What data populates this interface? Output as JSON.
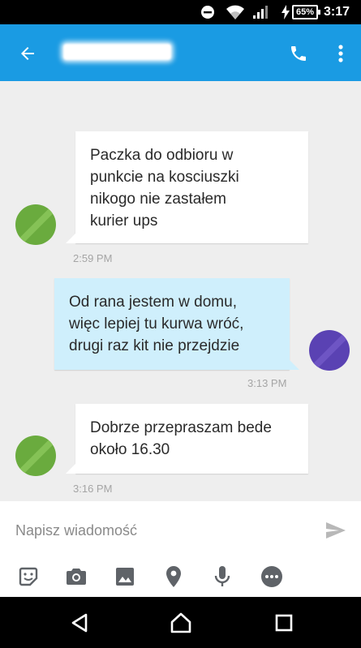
{
  "status_bar": {
    "battery_percent": "65%",
    "time": "3:17",
    "icons": [
      "do-not-disturb-icon",
      "wifi-icon",
      "signal-icon",
      "charging-bolt-icon",
      "battery-icon"
    ]
  },
  "app_bar": {
    "background": "#1a9be3",
    "icons": [
      "back-arrow-icon",
      "phone-icon",
      "more-vert-icon"
    ]
  },
  "messages": [
    {
      "direction": "incoming",
      "text": "Paczka do odbioru w\npunkcie na kosciuszki\nnikogo nie zastałem\nkurier ups",
      "timestamp": "2:59 PM"
    },
    {
      "direction": "outgoing",
      "text": "Od rana jestem w domu,\nwięc lepiej tu kurwa wróć,\ndrugi raz kit nie przejdzie",
      "timestamp": "3:13 PM"
    },
    {
      "direction": "incoming",
      "text": "Dobrze przepraszam bede\nokoło 16.30",
      "timestamp": "3:16 PM"
    }
  ],
  "colors": {
    "incoming_bubble": "#ffffff",
    "outgoing_bubble": "#cfeffc",
    "incoming_avatar": "#6aab3e",
    "outgoing_avatar": "#5a42b3"
  },
  "compose": {
    "placeholder": "Napisz wiadomość",
    "toolbar_icons": [
      "sticker-icon",
      "camera-icon",
      "image-icon",
      "location-pin-icon",
      "microphone-icon",
      "more-horiz-icon"
    ]
  },
  "nav_bar": {
    "icons": [
      "nav-back-icon",
      "nav-home-icon",
      "nav-recents-icon"
    ]
  }
}
